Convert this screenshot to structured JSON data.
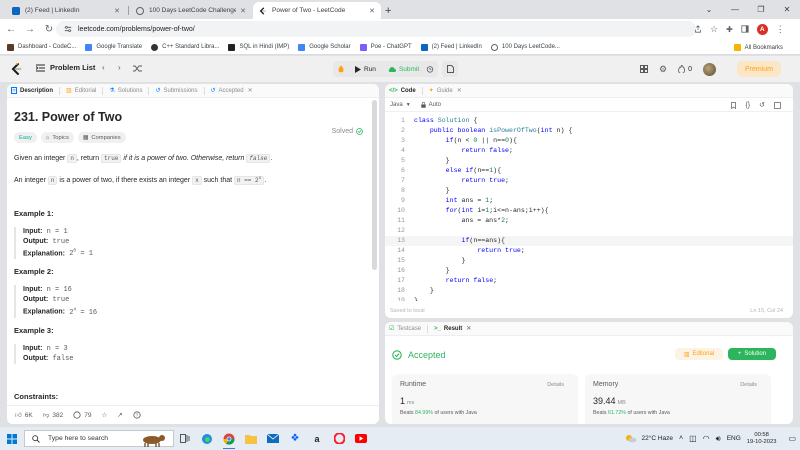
{
  "browser": {
    "tabs": [
      {
        "label": "(2) Feed | LinkedIn",
        "favicon_color": "#0a66c2",
        "active": false
      },
      {
        "label": "100 Days LeetCode Challenge",
        "favicon_color": "#5f6368",
        "active": false
      },
      {
        "label": "Power of Two - LeetCode",
        "favicon_color": "#1a1a1a",
        "active": true
      }
    ],
    "url": "leetcode.com/problems/power-of-two/",
    "avatar_letter": "A",
    "bookmarks": [
      {
        "label": "Dashboard - CodeC...",
        "color": "#5b3a29"
      },
      {
        "label": "Google Translate",
        "color": "#4285f4"
      },
      {
        "label": "C++ Standard Libra...",
        "color": "#333333"
      },
      {
        "label": "SQL in Hindi (IMP)",
        "color": "#222222"
      },
      {
        "label": "Google Scholar",
        "color": "#4285f4"
      },
      {
        "label": "Poe - ChatGPT",
        "color": "#7c5cff"
      },
      {
        "label": "(2) Feed | LinkedIn",
        "color": "#0a66c2"
      },
      {
        "label": "100 Days LeetCode...",
        "color": "#5f6368"
      }
    ],
    "all_bookmarks": "All Bookmarks"
  },
  "header": {
    "problem_list": "Problem List",
    "run": "Run",
    "submit": "Submit",
    "streak": "0",
    "premium": "Premium"
  },
  "left_panel": {
    "tabs": [
      "Description",
      "Editorial",
      "Solutions",
      "Submissions",
      "Accepted"
    ],
    "title": "231. Power of Two",
    "solved": "Solved",
    "chips": [
      "Easy",
      "Topics",
      "Companies"
    ],
    "para1": {
      "a": "Given an integer ",
      "n": "n",
      "b": ", return ",
      "true": "true",
      "c": " if it is a power of two. Otherwise, return ",
      "false": "false",
      "d": "."
    },
    "para2": {
      "a": "An integer ",
      "n": "n",
      "b": " is a power of two, if there exists an integer ",
      "x": "x",
      "c": " such that ",
      "expr": "n == 2",
      "sup": "x",
      "d": "."
    },
    "examples": [
      {
        "title": "Example 1:",
        "input_label": "Input:",
        "input": "n = 1",
        "output_label": "Output:",
        "output": "true",
        "explanation_label": "Explanation:",
        "explanation": "2",
        "exp_sup": "0",
        "explanation_tail": " = 1"
      },
      {
        "title": "Example 2:",
        "input_label": "Input:",
        "input": "n = 16",
        "output_label": "Output:",
        "output": "true",
        "explanation_label": "Explanation:",
        "explanation": "2",
        "exp_sup": "4",
        "explanation_tail": " = 16"
      },
      {
        "title": "Example 3:",
        "input_label": "Input:",
        "input": "n = 3",
        "output_label": "Output:",
        "output": "false"
      }
    ],
    "constraints_label": "Constraints:",
    "footer": {
      "likes": "6K",
      "dislikes": "382",
      "comments": "79"
    }
  },
  "code_panel": {
    "tabs": [
      "Code",
      "Guide"
    ],
    "language": "Java",
    "autocomplete": "Auto",
    "status_left": "Saved to local",
    "status_right": "Ln 15, Col 24",
    "lines": [
      {
        "n": "1",
        "html": "<span class=\"kw\">class</span> <span class=\"cl\">Solution</span> {"
      },
      {
        "n": "2",
        "html": "    <span class=\"kw\">public</span> <span class=\"ty\">boolean</span> <span class=\"cl\">isPowerOfTwo</span>(<span class=\"ty\">int</span> n) {"
      },
      {
        "n": "3",
        "html": "        <span class=\"kw\">if</span>(n &lt; <span class=\"nm\">0</span> || n==<span class=\"nm\">0</span>){"
      },
      {
        "n": "4",
        "html": "            <span class=\"kw\">return</span> <span class=\"kw\">false</span>;"
      },
      {
        "n": "5",
        "html": "        }"
      },
      {
        "n": "6",
        "html": "        <span class=\"kw\">else</span> <span class=\"kw\">if</span>(n==<span class=\"nm\">1</span>){"
      },
      {
        "n": "7",
        "html": "            <span class=\"kw\">return</span> <span class=\"kw\">true</span>;"
      },
      {
        "n": "8",
        "html": "        }"
      },
      {
        "n": "9",
        "html": "        <span class=\"ty\">int</span> ans = <span class=\"nm\">1</span>;"
      },
      {
        "n": "10",
        "html": "        <span class=\"kw\">for</span>(<span class=\"ty\">int</span> i=<span class=\"nm\">1</span>;i&lt;=n-ans;i++){"
      },
      {
        "n": "11",
        "html": "            ans = ans*<span class=\"nm\">2</span>;"
      },
      {
        "n": "12",
        "html": ""
      },
      {
        "n": "13",
        "html": "            <span class=\"kw\">if</span>(n==ans){"
      },
      {
        "n": "14",
        "html": "                <span class=\"kw\">return</span> <span class=\"kw\">true</span>;"
      },
      {
        "n": "15",
        "html": "            }"
      },
      {
        "n": "16",
        "html": "        }"
      },
      {
        "n": "17",
        "html": "        <span class=\"kw\">return</span> <span class=\"kw\">false</span>;"
      },
      {
        "n": "18",
        "html": "    }"
      },
      {
        "n": "19",
        "html": "}"
      }
    ],
    "current_line": "13"
  },
  "result_panel": {
    "tabs": [
      "Testcase",
      "Result"
    ],
    "status": "Accepted",
    "editorial_btn": "Editorial",
    "solution_btn": "Solution",
    "runtime": {
      "title": "Runtime",
      "details": "Details",
      "value": "1",
      "unit": "ms",
      "beats_a": "Beats ",
      "pct": "84.99%",
      "beats_b": " of users with Java"
    },
    "memory": {
      "title": "Memory",
      "details": "Details",
      "value": "39.44",
      "unit": "MB",
      "beats_a": "Beats ",
      "pct": "61.72%",
      "beats_b": " of users with Java"
    }
  },
  "taskbar": {
    "search_placeholder": "Type here to search",
    "weather": "22°C  Haze",
    "lang": "ENG",
    "time": "00:58",
    "date": "19-10-2023"
  },
  "colors": {
    "accent_green": "#2db55d",
    "brand_orange": "#ffa116",
    "easy": "#00af9b"
  }
}
